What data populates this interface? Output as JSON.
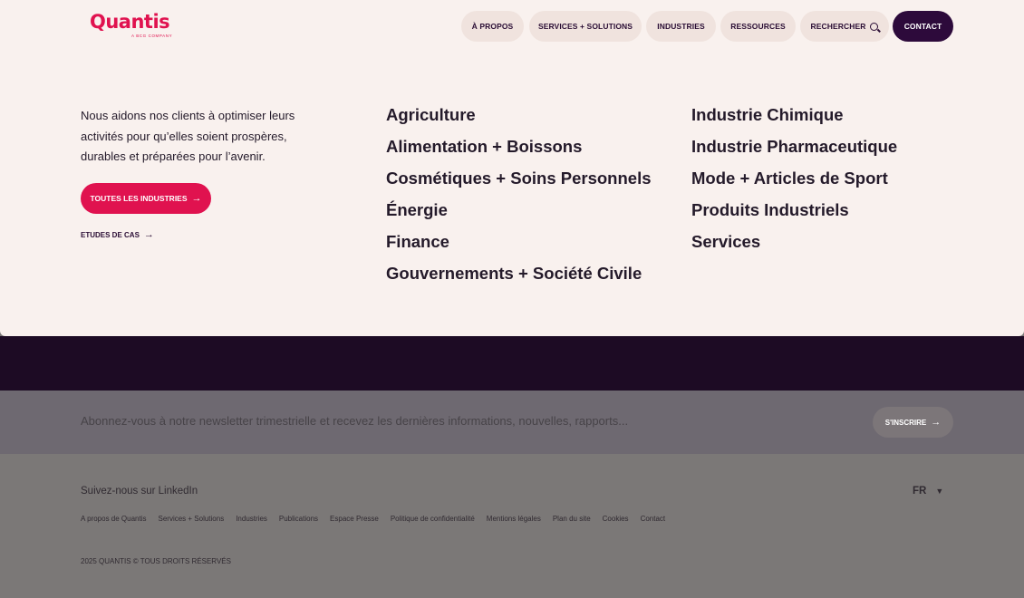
{
  "header": {
    "logo_text": "Quantis",
    "logo_subtext": "A BCG COMPANY",
    "nav": [
      {
        "label": "À PROPOS"
      },
      {
        "label": "SERVICES + SOLUTIONS"
      },
      {
        "label": "INDUSTRIES"
      },
      {
        "label": "RESSOURCES"
      },
      {
        "label": "RECHERCHER"
      },
      {
        "label": "CONTACT"
      }
    ]
  },
  "menu": {
    "intro": "Nous aidons nos clients à optimiser leurs activités pour qu’elles soient prospères, durables et préparées pour l’avenir.",
    "all_industries_label": "TOUTES LES INDUSTRIES",
    "case_studies_label": "ETUDES DE CAS",
    "arrow_glyph": "→",
    "industries_col1": [
      "Agriculture",
      "Alimentation + Boissons",
      "Cosmétiques + Soins Personnels",
      "Énergie",
      "Finance",
      "Gouvernements + Société Civile"
    ],
    "industries_col2": [
      "Industrie Chimique",
      "Industrie Pharmaceutique",
      "Mode + Articles de Sport",
      "Produits Industriels",
      "Services"
    ]
  },
  "newsletter": {
    "text": "Abonnez-vous à notre newsletter trimestrielle et recevez les dernières informations, nouvelles, rapports...",
    "button_label": "S'INSCRIRE"
  },
  "footer": {
    "follow_label": "Suivez-nous sur LinkedIn",
    "language": "FR",
    "language_caret": "▼",
    "links": [
      "A propos de Quantis",
      "Services + Solutions",
      "Industries",
      "Publications",
      "Espace Presse",
      "Politique de confidentialité",
      "Mentions légales",
      "Plan du site",
      "Cookies",
      "Contact"
    ],
    "copyright": "2025 QUANTIS © TOUS DROITS RÉSERVÉS"
  },
  "colors": {
    "brand_pink": "#e0124f",
    "brand_purple": "#2d0a3b",
    "panel_bg": "#f9f1ee",
    "pill_bg": "#f0e3de"
  }
}
